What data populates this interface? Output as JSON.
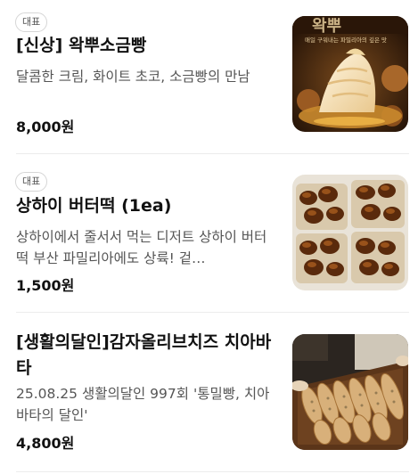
{
  "menu_items": [
    {
      "badge": "대표",
      "name": "[신상] 왁뿌소금빵",
      "description": "달콤한 크림, 화이트 초코, 소금빵의 만남",
      "price": "8,000원",
      "image_text": "매일 구워내는 파밀리아의 깊은 맛"
    },
    {
      "badge": "대표",
      "name": "상하이 버터떡 (1ea)",
      "description": "상하이에서 줄서서 먹는 디저트 상하이 버터떡 부산 파밀리아에도 상륙! 겉…",
      "price": "1,500원"
    },
    {
      "name": "[생활의달인]감자올리브치즈 치아바타",
      "description": "25.08.25 생활의달인 997회 '통밀빵, 치아바타의 달인'",
      "price": "4,800원"
    }
  ]
}
